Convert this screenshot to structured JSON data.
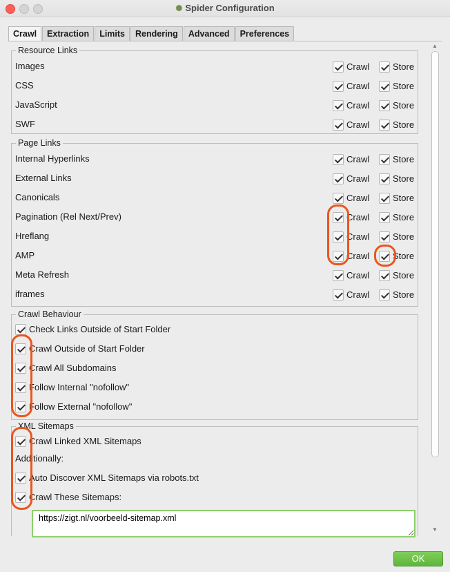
{
  "window": {
    "title": "Spider Configuration"
  },
  "tabs": [
    "Crawl",
    "Extraction",
    "Limits",
    "Rendering",
    "Advanced",
    "Preferences"
  ],
  "resource_links": {
    "legend": "Resource Links",
    "rows": [
      {
        "label": "Images",
        "crawl": "Crawl",
        "store": "Store"
      },
      {
        "label": "CSS",
        "crawl": "Crawl",
        "store": "Store"
      },
      {
        "label": "JavaScript",
        "crawl": "Crawl",
        "store": "Store"
      },
      {
        "label": "SWF",
        "crawl": "Crawl",
        "store": "Store"
      }
    ]
  },
  "page_links": {
    "legend": "Page Links",
    "rows": [
      {
        "label": "Internal Hyperlinks",
        "crawl": "Crawl",
        "store": "Store"
      },
      {
        "label": "External Links",
        "crawl": "Crawl",
        "store": "Store"
      },
      {
        "label": "Canonicals",
        "crawl": "Crawl",
        "store": "Store"
      },
      {
        "label": "Pagination (Rel Next/Prev)",
        "crawl": "Crawl",
        "store": "Store"
      },
      {
        "label": "Hreflang",
        "crawl": "Crawl",
        "store": "Store"
      },
      {
        "label": "AMP",
        "crawl": "Crawl",
        "store": "Store"
      },
      {
        "label": "Meta Refresh",
        "crawl": "Crawl",
        "store": "Store"
      },
      {
        "label": "iframes",
        "crawl": "Crawl",
        "store": "Store"
      }
    ]
  },
  "crawl_behaviour": {
    "legend": "Crawl Behaviour",
    "items": [
      "Check Links Outside of Start Folder",
      "Crawl Outside of Start Folder",
      "Crawl All Subdomains",
      "Follow Internal \"nofollow\"",
      "Follow External \"nofollow\""
    ]
  },
  "xml_sitemaps": {
    "legend": "XML Sitemaps",
    "crawl_linked": "Crawl Linked XML Sitemaps",
    "additionally": "Additionally:",
    "auto_discover": "Auto Discover XML Sitemaps via robots.txt",
    "crawl_these": "Crawl These Sitemaps:",
    "sitemap_url": "https://zigt.nl/voorbeeld-sitemap.xml"
  },
  "footer": {
    "ok_label": "OK"
  },
  "colors": {
    "highlight": "#e9561f",
    "ok_button": "#6cc046",
    "input_border": "#8fd06b"
  }
}
